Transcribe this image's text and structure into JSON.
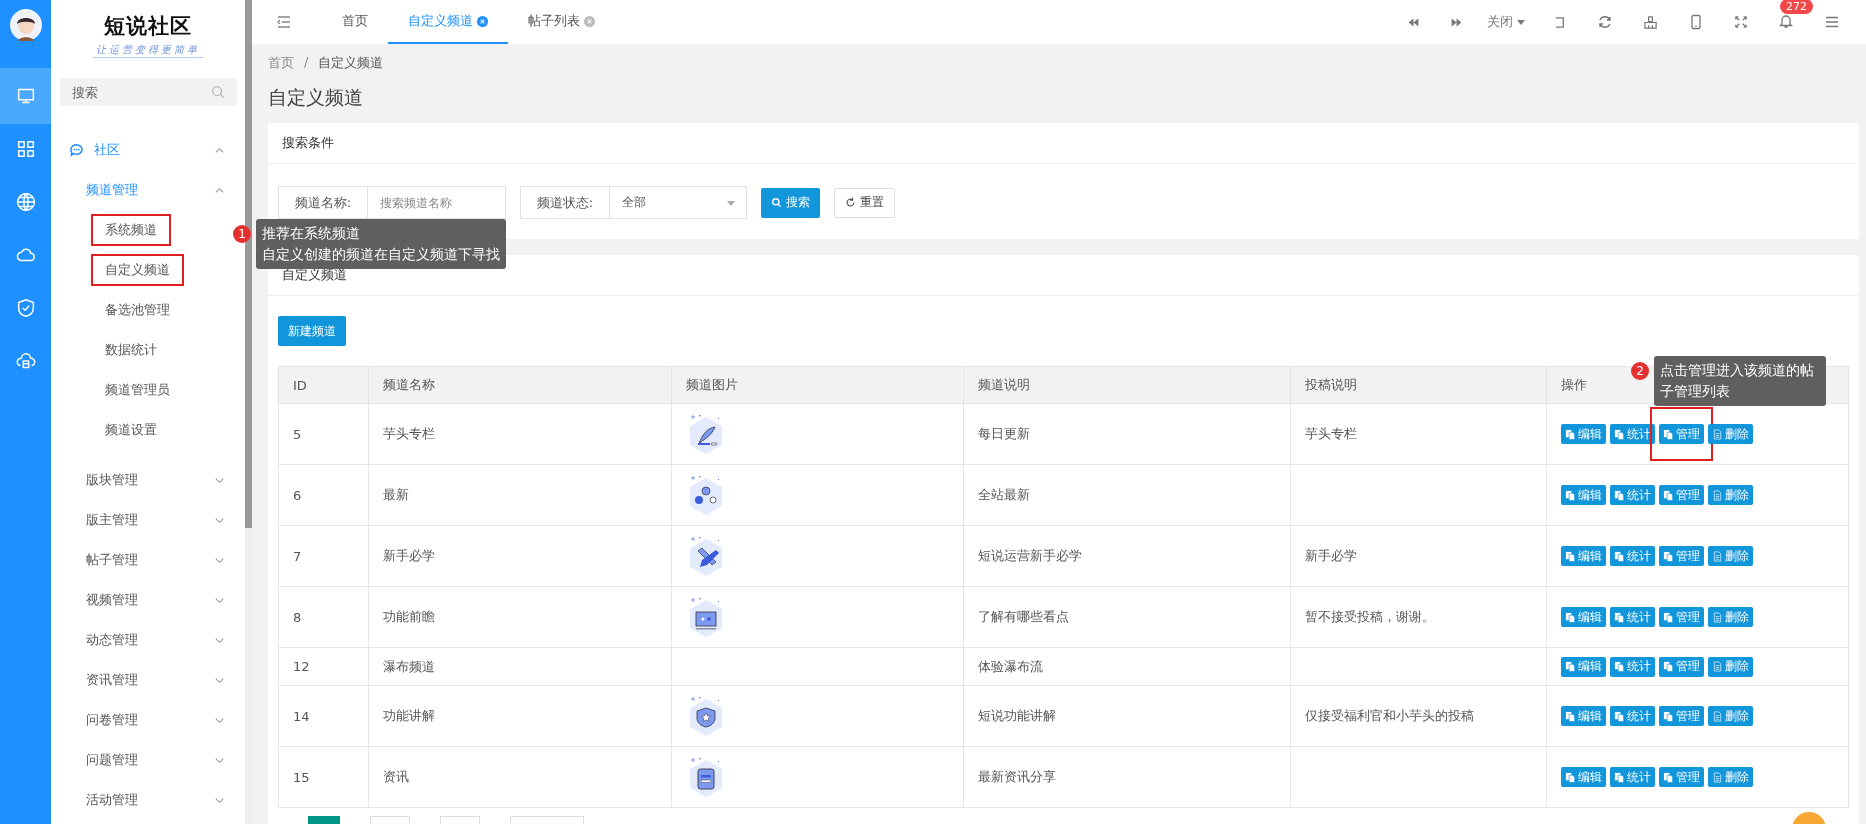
{
  "rail": {
    "items": [
      {
        "selected": true
      },
      {
        "selected": false
      },
      {
        "selected": false
      },
      {
        "selected": false
      },
      {
        "selected": false
      },
      {
        "selected": false
      }
    ]
  },
  "sidebar": {
    "logo": "短说社区",
    "tagline": "让运营变得更简单",
    "search": {
      "placeholder": "搜索"
    },
    "menu": [
      {
        "label": "社区",
        "expanded": true,
        "children": [
          {
            "label": "频道管理",
            "expanded": true,
            "children": [
              {
                "label": "系统频道",
                "highlighted": true,
                "annotation": {
                  "badge": "1",
                  "lines": [
                    "推荐在系统频道",
                    "自定义创建的频道在自定义频道下寻找"
                  ]
                }
              },
              {
                "label": "自定义频道",
                "highlighted": true
              },
              {
                "label": "备选池管理",
                "highlighted": false
              },
              {
                "label": "数据统计",
                "highlighted": false
              },
              {
                "label": "频道管理员",
                "highlighted": false
              },
              {
                "label": "频道设置",
                "highlighted": false
              }
            ]
          },
          {
            "label": "版块管理",
            "expanded": false
          },
          {
            "label": "版主管理",
            "expanded": false
          },
          {
            "label": "帖子管理",
            "expanded": false
          },
          {
            "label": "视频管理",
            "expanded": false
          },
          {
            "label": "动态管理",
            "expanded": false
          },
          {
            "label": "资讯管理",
            "expanded": false
          },
          {
            "label": "问卷管理",
            "expanded": false
          },
          {
            "label": "问题管理",
            "expanded": false
          },
          {
            "label": "活动管理",
            "expanded": false
          }
        ]
      }
    ]
  },
  "tabs": [
    {
      "label": "首页",
      "selected": false,
      "closable": false
    },
    {
      "label": "自定义频道",
      "selected": true,
      "closable": true
    },
    {
      "label": "帖子列表",
      "selected": false,
      "closable": true
    }
  ],
  "toolbar": {
    "close_menu": "关闭",
    "notifications": "272"
  },
  "breadcrumb": {
    "items": [
      "首页",
      "自定义频道"
    ],
    "separator": "/"
  },
  "page_title": "自定义频道",
  "search_card": {
    "title": "搜索条件",
    "name_label": "频道名称:",
    "name_placeholder": "搜索频道名称",
    "status_label": "频道状态:",
    "status_value": "全部",
    "search_button": "搜索",
    "reset_button": "重置"
  },
  "list_card": {
    "title": "自定义频道",
    "new_button": "新建频道"
  },
  "table": {
    "columns": [
      "ID",
      "频道名称",
      "频道图片",
      "频道说明",
      "投稿说明",
      "操作"
    ],
    "rows": [
      {
        "id": "5",
        "name": "芋头专栏",
        "has_image": true,
        "description": "每日更新",
        "contribution": "芋头专栏",
        "actions": [
          {
            "label": "编辑",
            "kind": "copy",
            "highlighted": false
          },
          {
            "label": "统计",
            "kind": "copy",
            "highlighted": false
          },
          {
            "label": "管理",
            "kind": "copy",
            "highlighted": true,
            "annotation": {
              "badge": "2",
              "lines": [
                "点击管理进入该频道的帖子管理列表"
              ]
            }
          },
          {
            "label": "删除",
            "kind": "file",
            "highlighted": false
          }
        ]
      },
      {
        "id": "6",
        "name": "最新",
        "has_image": true,
        "description": "全站最新",
        "actions": [
          {
            "label": "编辑",
            "kind": "copy",
            "highlighted": false
          },
          {
            "label": "统计",
            "kind": "copy",
            "highlighted": false
          },
          {
            "label": "管理",
            "kind": "copy",
            "highlighted": false
          },
          {
            "label": "删除",
            "kind": "file",
            "highlighted": false
          }
        ]
      },
      {
        "id": "7",
        "name": "新手必学",
        "has_image": true,
        "description": "短说运营新手必学",
        "contribution": "新手必学",
        "actions": [
          {
            "label": "编辑",
            "kind": "copy",
            "highlighted": false
          },
          {
            "label": "统计",
            "kind": "copy",
            "highlighted": false
          },
          {
            "label": "管理",
            "kind": "copy",
            "highlighted": false
          },
          {
            "label": "删除",
            "kind": "file",
            "highlighted": false
          }
        ]
      },
      {
        "id": "8",
        "name": "功能前瞻",
        "has_image": true,
        "description": "了解有哪些看点",
        "contribution": "暂不接受投稿，谢谢。",
        "actions": [
          {
            "label": "编辑",
            "kind": "copy",
            "highlighted": false
          },
          {
            "label": "统计",
            "kind": "copy",
            "highlighted": false
          },
          {
            "label": "管理",
            "kind": "copy",
            "highlighted": false
          },
          {
            "label": "删除",
            "kind": "file",
            "highlighted": false
          }
        ]
      },
      {
        "id": "12",
        "name": "瀑布频道",
        "has_image": false,
        "description": "体验瀑布流",
        "actions": [
          {
            "label": "编辑",
            "kind": "copy",
            "highlighted": false
          },
          {
            "label": "统计",
            "kind": "copy",
            "highlighted": false
          },
          {
            "label": "管理",
            "kind": "copy",
            "highlighted": false
          },
          {
            "label": "删除",
            "kind": "file",
            "highlighted": false
          }
        ]
      },
      {
        "id": "14",
        "name": "功能讲解",
        "has_image": true,
        "description": "短说功能讲解",
        "contribution": "仅接受福利官和小芋头的投稿",
        "actions": [
          {
            "label": "编辑",
            "kind": "copy",
            "highlighted": false
          },
          {
            "label": "统计",
            "kind": "copy",
            "highlighted": false
          },
          {
            "label": "管理",
            "kind": "copy",
            "highlighted": false
          },
          {
            "label": "删除",
            "kind": "file",
            "highlighted": false
          }
        ]
      },
      {
        "id": "15",
        "name": "资讯",
        "has_image": true,
        "description": "最新资讯分享",
        "actions": [
          {
            "label": "编辑",
            "kind": "copy",
            "highlighted": false
          },
          {
            "label": "统计",
            "kind": "copy",
            "highlighted": false
          },
          {
            "label": "管理",
            "kind": "copy",
            "highlighted": false
          },
          {
            "label": "删除",
            "kind": "file",
            "highlighted": false
          }
        ]
      }
    ]
  }
}
